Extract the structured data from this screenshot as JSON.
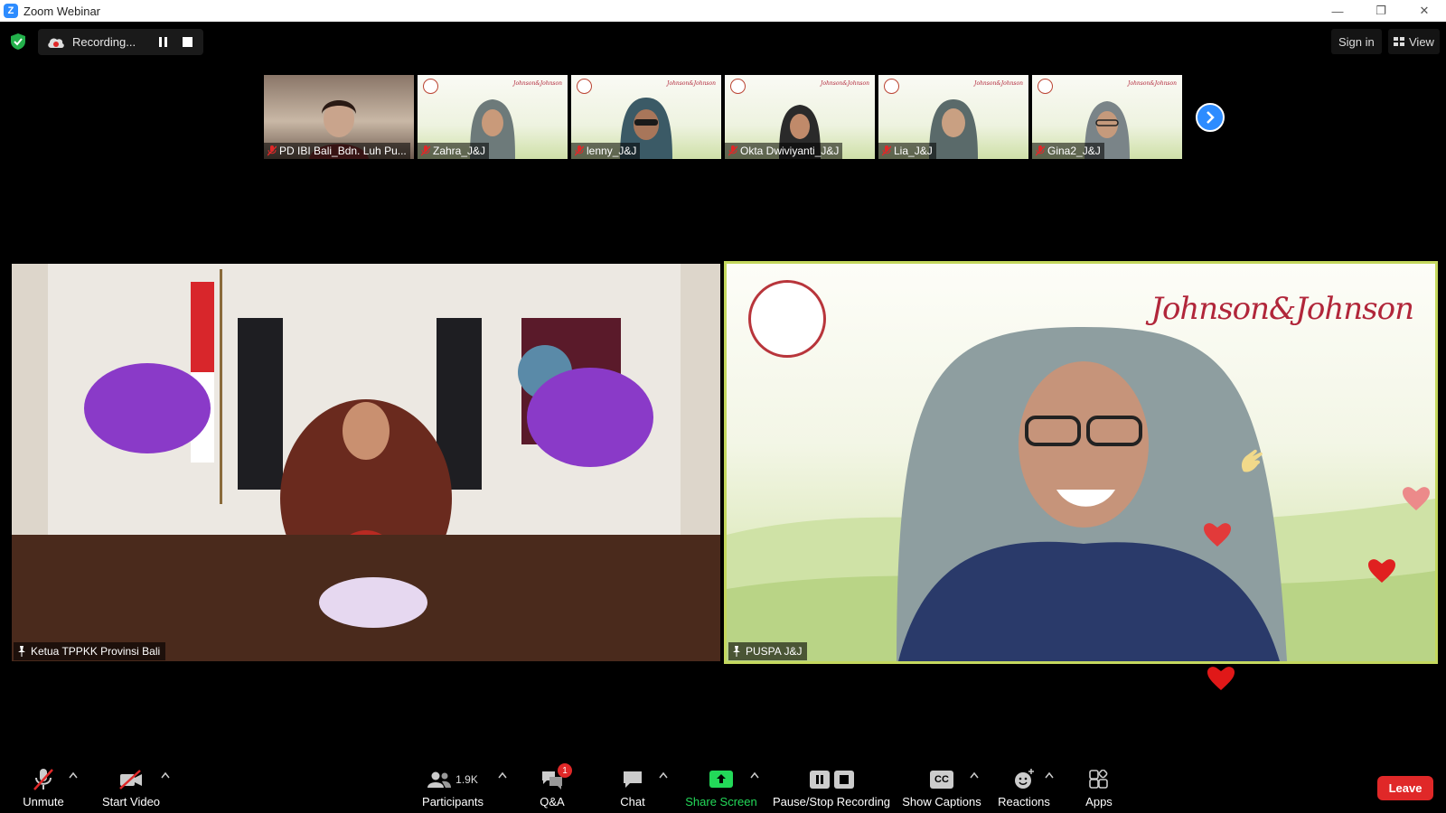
{
  "window": {
    "title": "Zoom Webinar",
    "minimize": "—",
    "restore": "❐",
    "close": "✕"
  },
  "topbar": {
    "recording_label": "Recording...",
    "sign_in": "Sign in",
    "view": "View"
  },
  "gallery": {
    "thumbnails": [
      {
        "name": "PD IBI Bali_Bdn. Luh Pu..."
      },
      {
        "name": "Zahra_J&J"
      },
      {
        "name": "lenny_J&J"
      },
      {
        "name": "Okta Dwiviyanti_J&J"
      },
      {
        "name": "Lia_J&J"
      },
      {
        "name": "Gina2_J&J"
      }
    ],
    "thumb_brand": "Johnson&Johnson"
  },
  "main": {
    "left_video_name": "Ketua TPPKK Provinsi Bali",
    "right_video_name": "PUSPA J&J",
    "right_brand": "Johnson&Johnson"
  },
  "toolbar": {
    "unmute": "Unmute",
    "start_video": "Start Video",
    "participants": "Participants",
    "participants_count": "1.9K",
    "qa": "Q&A",
    "qa_badge": "1",
    "chat": "Chat",
    "share_screen": "Share Screen",
    "pause_stop_recording": "Pause/Stop Recording",
    "show_captions": "Show Captions",
    "captions_icon_text": "CC",
    "reactions": "Reactions",
    "apps": "Apps",
    "leave": "Leave"
  },
  "colors": {
    "accent_blue": "#2d8cff",
    "share_green": "#23d959",
    "leave_red": "#e02828",
    "active_speaker_border": "#c4d85e",
    "brand_red": "#b1263a"
  }
}
